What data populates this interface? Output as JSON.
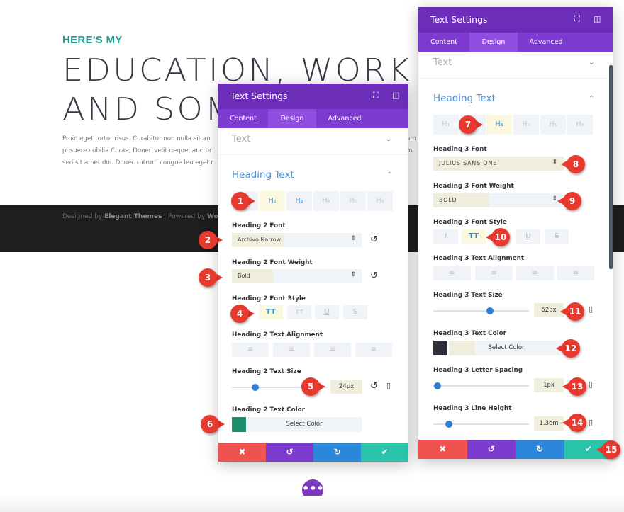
{
  "page": {
    "kicker": "HERE'S MY",
    "heading_line1": "EDUCATION, WORK EXI",
    "heading_line2": "AND SOM",
    "paragraph": [
      "Proin eget tortor risus. Curabitur non nulla sit an",
      "posuere cubilia Curae; Donec velit neque, auctor",
      "sed sit amet dui. Donec rutrum congue leo eget r"
    ],
    "para_right": [
      "um",
      "m"
    ],
    "footer": {
      "prefix": "Designed by ",
      "brand": "Elegant Themes",
      "mid": " | Powered by ",
      "wp": "Wor"
    },
    "fab_label": "•••"
  },
  "left_panel": {
    "title": "Text Settings",
    "tabs": [
      "Content",
      "Design",
      "Advanced"
    ],
    "active_tab": "Design",
    "text_section": "Text",
    "heading_section": "Heading Text",
    "heading_levels": [
      "H₂",
      "H₃",
      "H₄",
      "H₅",
      "H₆"
    ],
    "active_level": "H₂",
    "font_label": "Heading 2 Font",
    "font_value": "Archivo Narrow",
    "weight_label": "Heading 2 Font Weight",
    "weight_value": "Bold",
    "style_label": "Heading 2 Font Style",
    "styles": [
      "TT",
      "Tт",
      "U",
      "S"
    ],
    "align_label": "Heading 2 Text Alignment",
    "align": [
      "≡",
      "≡",
      "≡",
      "≡"
    ],
    "size_label": "Heading 2 Text Size",
    "size_value": "24px",
    "color_label": "Heading 2 Text Color",
    "color": "#1a8f6a",
    "color_button": "Select Color",
    "footer": [
      "✖",
      "↺",
      "↻",
      "✔"
    ]
  },
  "right_panel": {
    "title": "Text Settings",
    "tabs": [
      "Content",
      "Design",
      "Advanced"
    ],
    "active_tab": "Design",
    "text_section": "Text",
    "heading_section": "Heading Text",
    "heading_levels": [
      "H₁",
      "H₃",
      "H₄",
      "H₅",
      "H₆"
    ],
    "active_level": "H₃",
    "font_label": "Heading 3 Font",
    "font_value": "JULIUS SANS ONE",
    "weight_label": "Heading 3 Font Weight",
    "weight_value": "BOLD",
    "style_label": "Heading 3 Font Style",
    "styles": [
      "I",
      "TT",
      "U",
      "S"
    ],
    "align_label": "Heading 3 Text Alignment",
    "align": [
      "≡",
      "≡",
      "≡",
      "≡"
    ],
    "size_label": "Heading 3 Text Size",
    "size_value": "62px",
    "color_label": "Heading 3 Text Color",
    "color": "#2e2e38",
    "color_button": "Select Color",
    "spacing_label": "Heading 3 Letter Spacing",
    "spacing_value": "1px",
    "lineheight_label": "Heading 3 Line Height",
    "lineheight_value": "1.3em",
    "footer": [
      "✖",
      "↺",
      "↻",
      "✔"
    ]
  },
  "colors": {
    "purple_header": "#6c2eb9",
    "tabs": "#7e3bd0",
    "cancel": "#ef5350",
    "undo": "#7e3bd0",
    "redo": "#2b87da",
    "save": "#29c4a9",
    "marker": "#e8392e",
    "accent_blue": "#2f88c8"
  },
  "markers": [
    "1",
    "2",
    "3",
    "4",
    "5",
    "6",
    "7",
    "8",
    "9",
    "10",
    "11",
    "12",
    "13",
    "14",
    "15"
  ]
}
